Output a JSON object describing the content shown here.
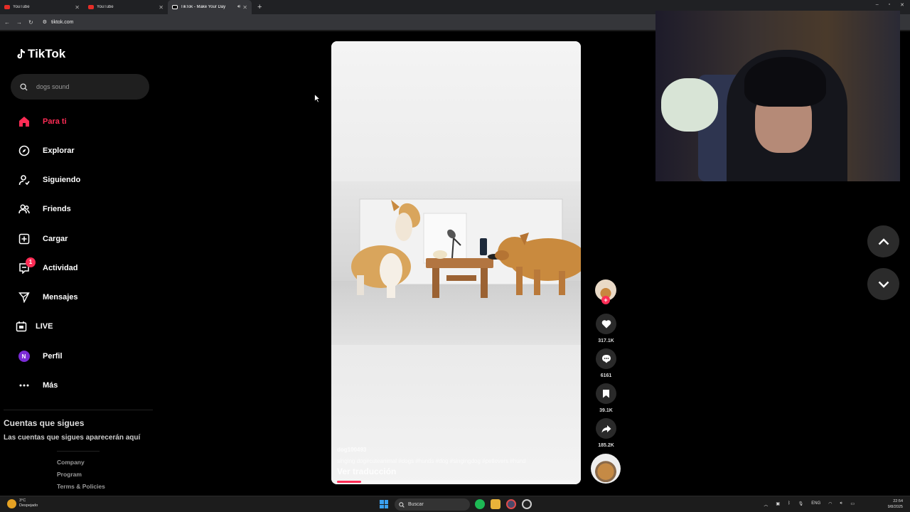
{
  "browser": {
    "tabs": [
      {
        "title": "YouTube",
        "active": false
      },
      {
        "title": "YouTube",
        "active": false
      },
      {
        "title": "TikTok - Make Your Day",
        "active": true
      }
    ],
    "new_tab": "+",
    "url": "tiktok.com",
    "window_controls": [
      "–",
      "▫",
      "✕"
    ]
  },
  "sidebar": {
    "logo_text": "TikTok",
    "search_placeholder": "dogs sound",
    "nav": [
      {
        "label": "Para ti",
        "icon": "home-icon",
        "active": true
      },
      {
        "label": "Explorar",
        "icon": "compass-icon"
      },
      {
        "label": "Siguiendo",
        "icon": "user-follow-icon"
      },
      {
        "label": "Friends",
        "icon": "friends-icon"
      },
      {
        "label": "Cargar",
        "icon": "upload-icon"
      },
      {
        "label": "Actividad",
        "icon": "activity-icon",
        "badge": "1"
      },
      {
        "label": "Mensajes",
        "icon": "send-icon"
      },
      {
        "label": "LIVE",
        "icon": "live-icon"
      },
      {
        "label": "Perfil",
        "icon": "profile-avatar",
        "avatar_letter": "N"
      },
      {
        "label": "Más",
        "icon": "more-icon"
      }
    ],
    "following_title": "Cuentas que sigues",
    "following_subtitle": "Las cuentas que sigues aparecerán aquí",
    "footer_links": [
      "Company",
      "Program",
      "Terms & Policies"
    ]
  },
  "video": {
    "username": "dog100493",
    "description": "singing dog#cuteanimal  #dogs  #hunds  #dog  #singingdog  #petlovers  #hund",
    "translate": "Ver traducción",
    "progress": 0.1
  },
  "actions": {
    "likes": "317.1K",
    "comments": "6161",
    "saves": "39.1K",
    "shares": "185.2K",
    "follow_plus": "+"
  },
  "taskbar": {
    "weather_temp": "3°C",
    "weather_desc": "Despejado",
    "search_label": "Buscar",
    "language": "ENG",
    "time": "22:54",
    "date": "9/8/2025"
  },
  "colors": {
    "accent": "#fe2c55",
    "background": "#000000"
  }
}
